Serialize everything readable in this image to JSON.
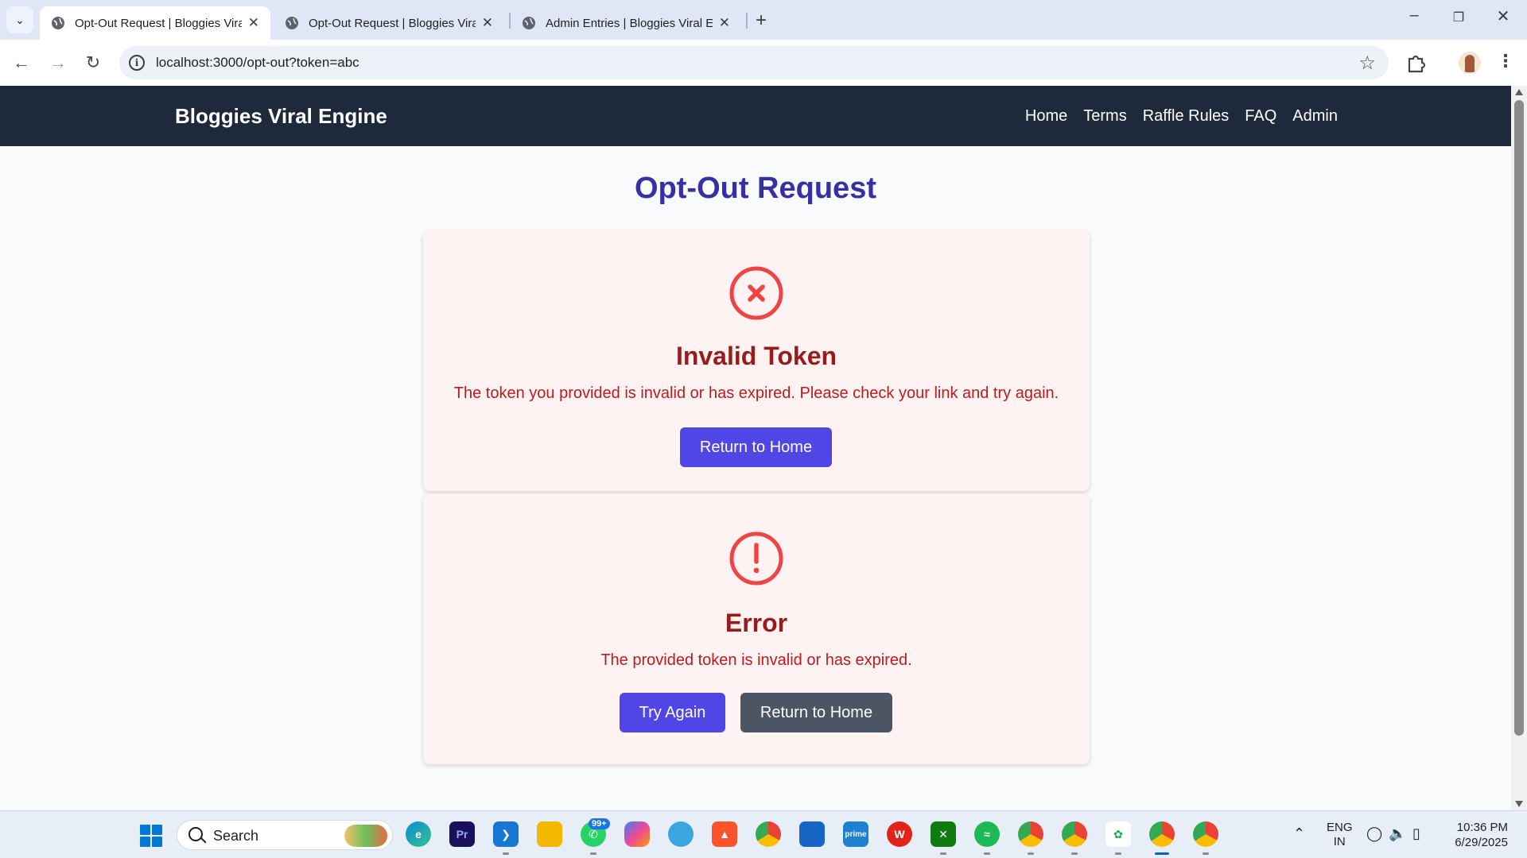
{
  "browser": {
    "tabs": [
      {
        "label": "Opt-Out Request | Bloggies Viral Engine",
        "active": true
      },
      {
        "label": "Opt-Out Request | Bloggies Viral Engine",
        "active": false
      },
      {
        "label": "Admin Entries | Bloggies Viral Engine",
        "active": false
      }
    ],
    "url": "localhost:3000/opt-out?token=abc",
    "info_glyph": "i"
  },
  "site": {
    "brand": "Bloggies Viral Engine",
    "nav": [
      "Home",
      "Terms",
      "Raffle Rules",
      "FAQ",
      "Admin"
    ]
  },
  "page": {
    "title": "Opt-Out Request",
    "invalid_card": {
      "icon": "x-circle-icon",
      "heading": "Invalid Token",
      "message": "The token you provided is invalid or has expired. Please check your link and try again.",
      "home_button": "Return to Home"
    },
    "error_card": {
      "icon": "exclamation-circle-icon",
      "heading": "Error",
      "message": "The provided token is invalid or has expired.",
      "try_button": "Try Again",
      "home_button": "Return to Home"
    },
    "colors": {
      "navbar": "#1e293b",
      "title": "#3730a3",
      "card_bg": "#fef2f2",
      "error_text": "#991b1b",
      "icon_red": "#ef4444",
      "primary_button": "#4f46e5",
      "secondary_button": "#4b5563"
    }
  },
  "taskbar": {
    "search_placeholder": "Search",
    "whatsapp_badge": "99+",
    "lang_line1": "ENG",
    "lang_line2": "IN",
    "time": "10:36 PM",
    "date": "6/29/2025"
  }
}
